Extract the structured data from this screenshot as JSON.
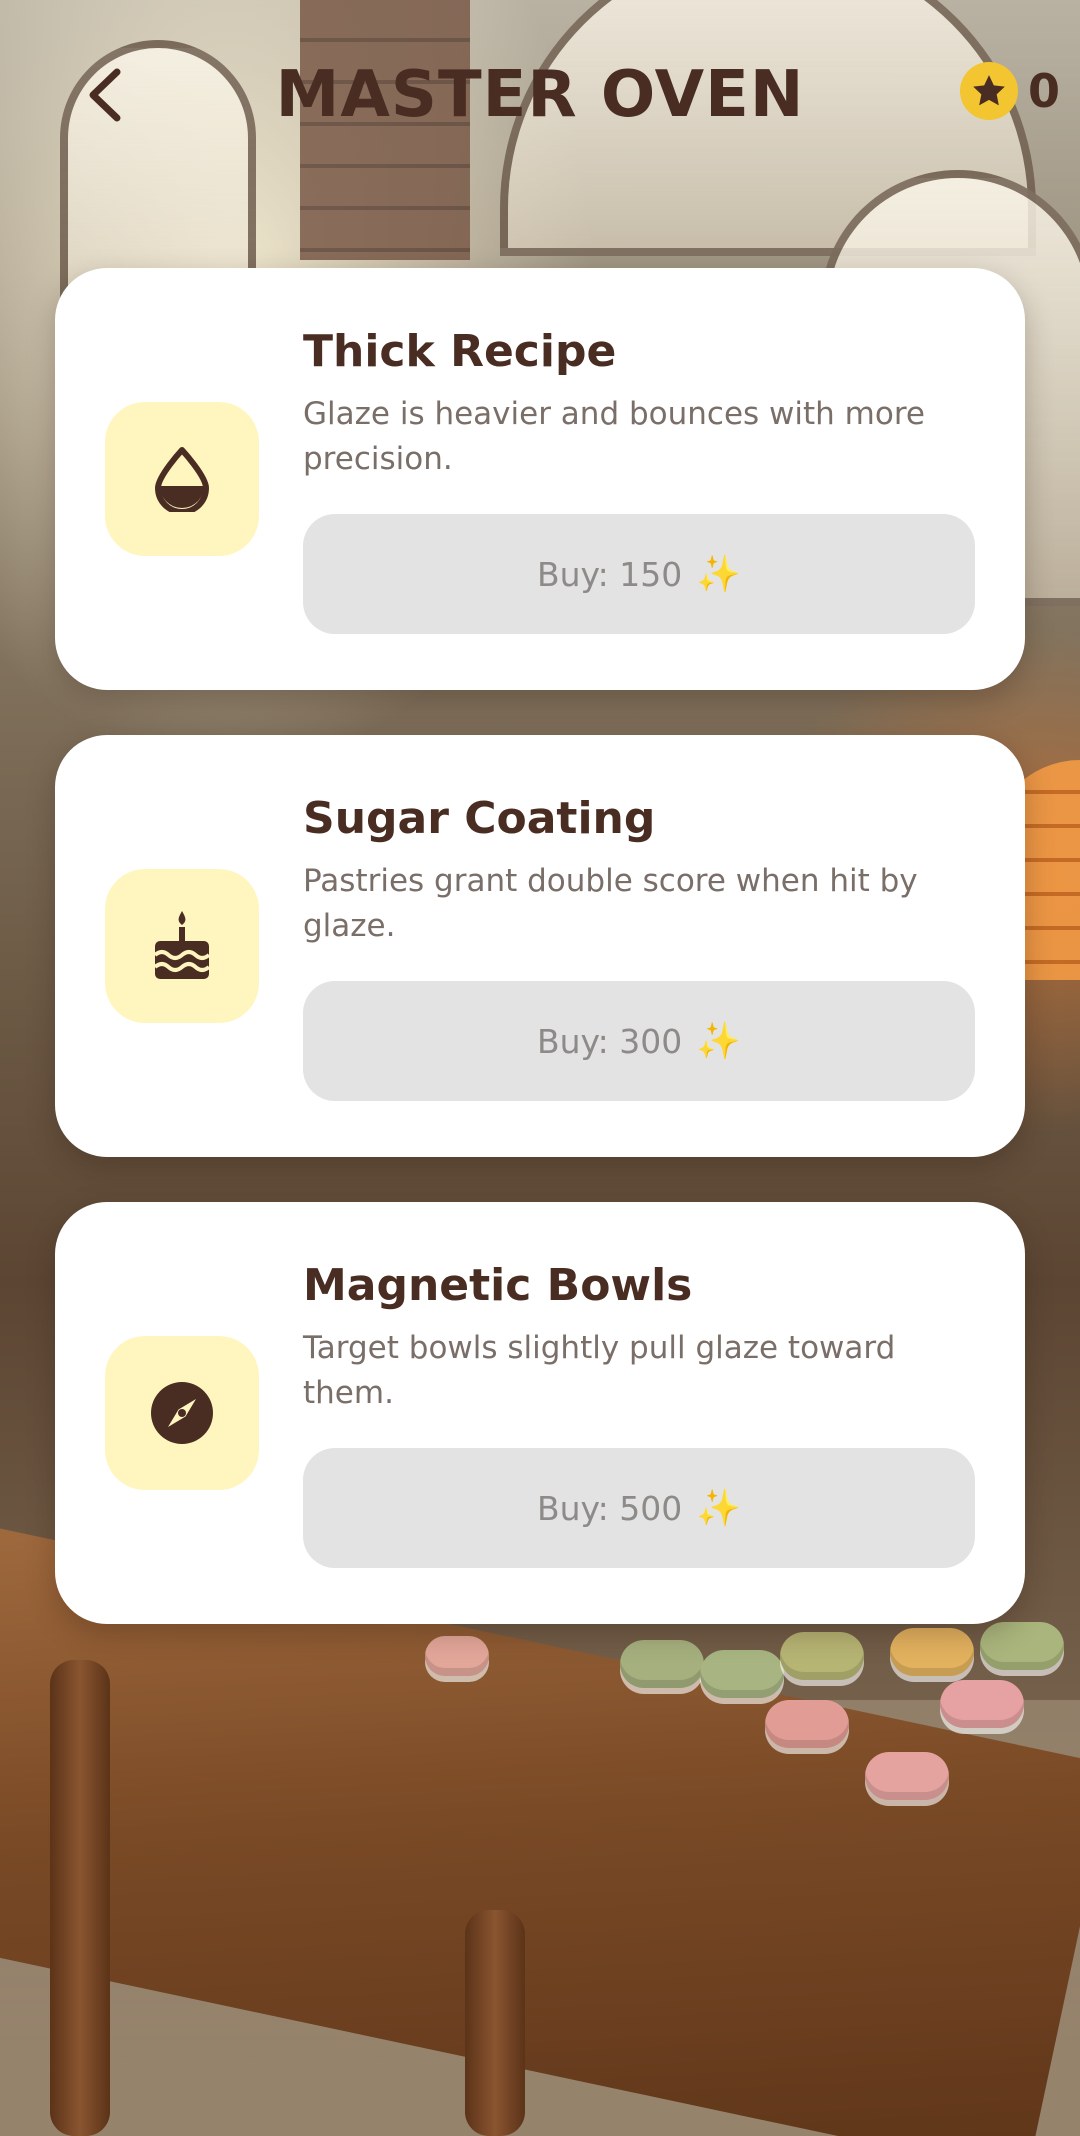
{
  "header": {
    "title": "MASTER OVEN",
    "score": "0",
    "back_icon": "chevron-left-icon",
    "score_icon": "star-icon"
  },
  "upgrades": [
    {
      "icon": "droplet-icon",
      "title": "Thick Recipe",
      "description": "Glaze is heavier and bounces with more precision.",
      "button_label": "Buy: 150",
      "button_icon": "sparkles-icon"
    },
    {
      "icon": "cake-icon",
      "title": "Sugar Coating",
      "description": "Pastries grant double score when hit by glaze.",
      "button_label": "Buy: 300",
      "button_icon": "sparkles-icon"
    },
    {
      "icon": "compass-icon",
      "title": "Magnetic Bowls",
      "description": "Target bowls slightly pull glaze toward them.",
      "button_label": "Buy: 500",
      "button_icon": "sparkles-icon"
    }
  ],
  "colors": {
    "title_text": "#4a2d22",
    "card_bg": "#ffffff",
    "icon_tile": "#fff6bf",
    "button_bg": "#e3e3e3",
    "button_text": "#8d8a88",
    "star_badge": "#f2c531"
  }
}
